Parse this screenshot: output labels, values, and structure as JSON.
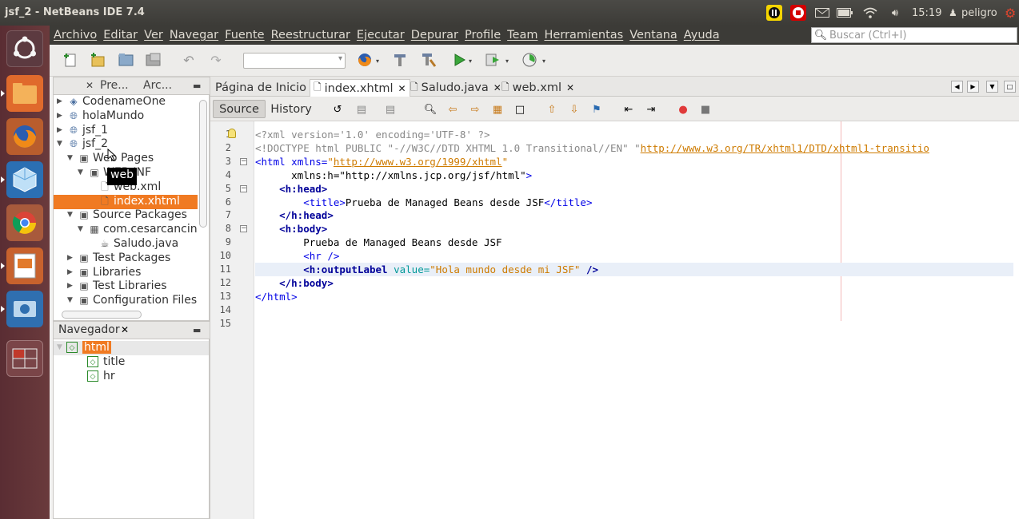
{
  "window": {
    "title": "jsf_2 - NetBeans IDE 7.4"
  },
  "topbar": {
    "time": "15:19",
    "user": "peligro"
  },
  "menu": [
    "Archivo",
    "Editar",
    "Ver",
    "Navegar",
    "Fuente",
    "Reestructurar",
    "Ejecutar",
    "Depurar",
    "Profile",
    "Team",
    "Herramientas",
    "Ventana",
    "Ayuda"
  ],
  "search": {
    "placeholder": "Buscar (Ctrl+I)"
  },
  "project_panel": {
    "tabs": [
      "Pre...",
      "Arc..."
    ],
    "tooltip": "web",
    "tree": [
      {
        "label": "CodenameOne",
        "level": 0,
        "arrow": "closed"
      },
      {
        "label": "holaMundo",
        "level": 0,
        "arrow": "closed"
      },
      {
        "label": "jsf_1",
        "level": 0,
        "arrow": "closed"
      },
      {
        "label": "jsf_2",
        "level": 0,
        "arrow": "open"
      },
      {
        "label": "Web Pages",
        "level": 1,
        "arrow": "open"
      },
      {
        "label": "WEB-INF",
        "level": 2,
        "arrow": "open"
      },
      {
        "label": "web.xml",
        "level": 3,
        "arrow": "none"
      },
      {
        "label": "index.xhtml",
        "level": 3,
        "arrow": "none",
        "selected": true
      },
      {
        "label": "Source Packages",
        "level": 1,
        "arrow": "open"
      },
      {
        "label": "com.cesarcancin",
        "level": 2,
        "arrow": "open"
      },
      {
        "label": "Saludo.java",
        "level": 3,
        "arrow": "none"
      },
      {
        "label": "Test Packages",
        "level": 1,
        "arrow": "closed"
      },
      {
        "label": "Libraries",
        "level": 1,
        "arrow": "closed"
      },
      {
        "label": "Test Libraries",
        "level": 1,
        "arrow": "closed"
      },
      {
        "label": "Configuration Files",
        "level": 1,
        "arrow": "open"
      }
    ]
  },
  "navigator": {
    "title": "Navegador",
    "items": [
      {
        "label": "html",
        "level": 0,
        "selected": true
      },
      {
        "label": "title",
        "level": 1
      },
      {
        "label": "hr",
        "level": 1
      }
    ]
  },
  "editor": {
    "tabs": [
      "Página de Inicio",
      "index.xhtml",
      "Saludo.java",
      "web.xml"
    ],
    "active_tab": 1,
    "source_label": "Source",
    "history_label": "History",
    "current_line": 11,
    "lines": [
      "<?xml version='1.0' encoding='UTF-8' ?>",
      "<!DOCTYPE html PUBLIC \"-//W3C//DTD XHTML 1.0 Transitional//EN\" \"http://www.w3.org/TR/xhtml1/DTD/xhtml1-transitio",
      "<html xmlns=\"http://www.w3.org/1999/xhtml\"",
      "      xmlns:h=\"http://xmlns.jcp.org/jsf/html\">",
      "    <h:head>",
      "        <title>Prueba de Managed Beans desde JSF</title>",
      "    </h:head>",
      "    <h:body>",
      "        Prueba de Managed Beans desde JSF",
      "        <hr />",
      "        <h:outputLabel value=\"Hola mundo desde mi JSF\" />",
      "    </h:body>",
      "</html>",
      "",
      ""
    ]
  }
}
